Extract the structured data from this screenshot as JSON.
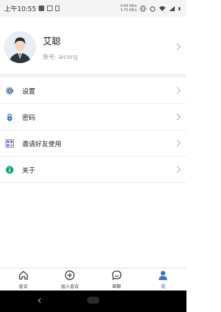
{
  "status_bar": {
    "time": "上午10:55",
    "net_speed_up": "4.68 KB/s",
    "net_speed_down": "3.75 KB/s"
  },
  "profile": {
    "name": "艾聪",
    "account": "账号: aicong"
  },
  "menu": {
    "items": [
      {
        "label": "设置",
        "icon": "gear-icon"
      },
      {
        "label": "密码",
        "icon": "lock-icon"
      },
      {
        "label": "邀请好友使用",
        "icon": "qr-code-icon"
      },
      {
        "label": "关于",
        "icon": "info-icon"
      }
    ]
  },
  "tabbar": {
    "tabs": [
      {
        "label": "会议",
        "icon": "home-icon"
      },
      {
        "label": "加入会议",
        "icon": "plus-circle-icon"
      },
      {
        "label": "单聊",
        "icon": "chat-icon"
      },
      {
        "label": "我",
        "icon": "user-icon",
        "active": true
      }
    ]
  },
  "colors": {
    "accent": "#3b78c2",
    "info_green": "#17a36a",
    "gear_blue": "#4d6aa0"
  }
}
